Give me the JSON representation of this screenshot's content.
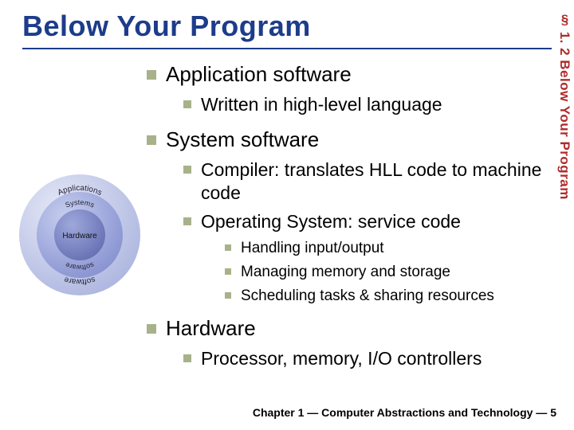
{
  "slide": {
    "title": "Below Your Program",
    "section_ref": "§ 1. 2 Below Your Program",
    "footer": "Chapter 1 — Computer Abstractions and Technology — 5"
  },
  "content": {
    "app": {
      "heading": "Application software",
      "sub1": "Written in high-level language"
    },
    "sys": {
      "heading": "System software",
      "sub1": "Compiler: translates HLL code to machine code",
      "sub2": "Operating System: service code",
      "os1": "Handling input/output",
      "os2": "Managing memory and storage",
      "os3": "Scheduling tasks & sharing resources"
    },
    "hw": {
      "heading": "Hardware",
      "sub1": "Processor, memory, I/O controllers"
    }
  },
  "diagram": {
    "outer_label_top": "Applications",
    "outer_label_bottom": "software",
    "mid_label_top": "Systems",
    "mid_label_bottom": "software",
    "inner_label": "Hardware",
    "colors": {
      "outer": "#b7bfe6",
      "mid": "#8a97d6",
      "inner": "#5e6fb8",
      "text": "#223"
    }
  }
}
